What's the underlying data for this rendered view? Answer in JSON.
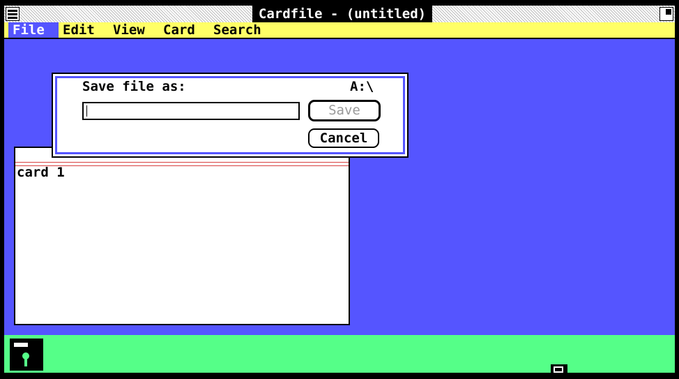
{
  "window": {
    "title": "Cardfile - (untitled)"
  },
  "menu": {
    "items": [
      {
        "label": "File",
        "active": true
      },
      {
        "label": "Edit",
        "active": false
      },
      {
        "label": "View",
        "active": false
      },
      {
        "label": "Card",
        "active": false
      },
      {
        "label": "Search",
        "active": false
      }
    ]
  },
  "dialog": {
    "prompt": "Save file as:",
    "path": "A:\\",
    "filename_value": "",
    "save_label": "Save",
    "cancel_label": "Cancel"
  },
  "card": {
    "index_text": "",
    "body_text": "card 1"
  },
  "icons": {
    "system_menu": "system-menu-icon",
    "maximize": "maximize-icon",
    "disk": "floppy-disk-icon",
    "minimized_window": "minimized-window-icon"
  },
  "colors": {
    "workspace": "#5555ff",
    "menubar": "#ffff66",
    "iconarea": "#55ff88",
    "title_active": "#000000",
    "menu_highlight": "#5555ff"
  }
}
